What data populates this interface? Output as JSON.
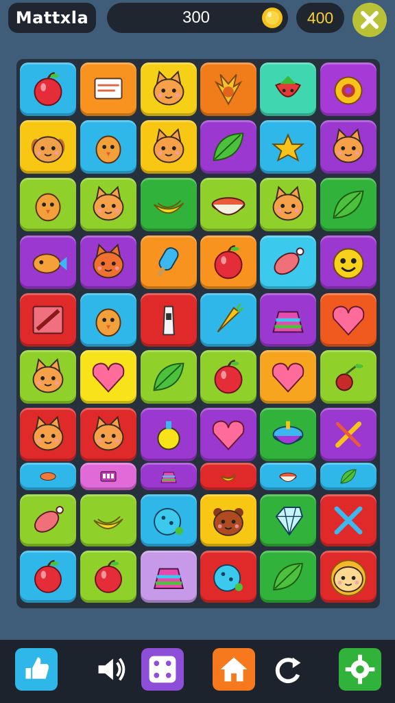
{
  "header": {
    "logo_text": "Mattxla",
    "score": "300",
    "best": "400"
  },
  "board": {
    "rows": [
      [
        {
          "color": "#2fb7ea",
          "icon": "apple-icon"
        },
        {
          "color": "#f7931e",
          "icon": "paper-icon"
        },
        {
          "color": "#f5d016",
          "icon": "cat-icon"
        },
        {
          "color": "#f07c1a",
          "icon": "phoenix-icon"
        },
        {
          "color": "#3fd6b0",
          "icon": "strawberry-icon"
        },
        {
          "color": "#a53ad6",
          "icon": "donut-icon"
        }
      ],
      [
        {
          "color": "#f8c713",
          "icon": "dog-icon"
        },
        {
          "color": "#2fb7ea",
          "icon": "bird-icon"
        },
        {
          "color": "#f8c713",
          "icon": "cat-icon"
        },
        {
          "color": "#9b38d0",
          "icon": "leaf-icon"
        },
        {
          "color": "#2fb7ea",
          "icon": "star-fish-icon"
        },
        {
          "color": "#9b38d0",
          "icon": "cat-icon"
        }
      ],
      [
        {
          "color": "#8fd12a",
          "icon": "bird-icon"
        },
        {
          "color": "#8fd12a",
          "icon": "cat-icon"
        },
        {
          "color": "#31b23a",
          "icon": "banana-icon"
        },
        {
          "color": "#8fd12a",
          "icon": "bowl-icon"
        },
        {
          "color": "#8fd12a",
          "icon": "cat-icon"
        },
        {
          "color": "#31b23a",
          "icon": "leaf-icon"
        }
      ],
      [
        {
          "color": "#9b38d0",
          "icon": "fish-icon"
        },
        {
          "color": "#9b38d0",
          "icon": "fox-icon"
        },
        {
          "color": "#f7931e",
          "icon": "popsicle-icon"
        },
        {
          "color": "#f7931e",
          "icon": "apple-icon"
        },
        {
          "color": "#3cc9ee",
          "icon": "meat-icon"
        },
        {
          "color": "#9b38d0",
          "icon": "smiley-icon"
        }
      ],
      [
        {
          "color": "#e02a2a",
          "icon": "pencil-icon"
        },
        {
          "color": "#2fb7ea",
          "icon": "bird-icon"
        },
        {
          "color": "#e02a2a",
          "icon": "bottle-icon"
        },
        {
          "color": "#2fb7ea",
          "icon": "carrot-icon"
        },
        {
          "color": "#9b38d0",
          "icon": "cake-icon"
        },
        {
          "color": "#f05a1e",
          "icon": "heart-icon"
        }
      ],
      [
        {
          "color": "#8fd12a",
          "icon": "cat-icon"
        },
        {
          "color": "#f8e21a",
          "icon": "heart-icon"
        },
        {
          "color": "#8fd12a",
          "icon": "leaf-icon"
        },
        {
          "color": "#8fd12a",
          "icon": "apple-icon"
        },
        {
          "color": "#f7a41e",
          "icon": "heart-icon"
        },
        {
          "color": "#8fd12a",
          "icon": "cherry-icon"
        }
      ],
      [
        {
          "color": "#e02a2a",
          "icon": "cat-icon"
        },
        {
          "color": "#e02a2a",
          "icon": "cat-icon"
        },
        {
          "color": "#9b38d0",
          "icon": "potion-icon"
        },
        {
          "color": "#9b38d0",
          "icon": "heart-icon"
        },
        {
          "color": "#31b23a",
          "icon": "spinning-top-icon"
        },
        {
          "color": "#9b38d0",
          "icon": "tools-icon"
        }
      ]
    ],
    "short_row": [
      {
        "color": "#2fb7ea",
        "icon": "bread-icon"
      },
      {
        "color": "#e06ad8",
        "icon": "panel-icon"
      },
      {
        "color": "#9b38d0",
        "icon": "cake-icon"
      },
      {
        "color": "#e02a2a",
        "icon": "banana-icon"
      },
      {
        "color": "#2fb7ea",
        "icon": "bowl-icon"
      },
      {
        "color": "#2fb7ea",
        "icon": "leaf-icon"
      }
    ],
    "rows_bottom": [
      [
        {
          "color": "#8fd12a",
          "icon": "meat-icon"
        },
        {
          "color": "#8fd12a",
          "icon": "banana-icon"
        },
        {
          "color": "#2fb7ea",
          "icon": "bubble-icon"
        },
        {
          "color": "#f8c713",
          "icon": "bear-icon"
        },
        {
          "color": "#31b23a",
          "icon": "gem-icon"
        },
        {
          "color": "#e02a2a",
          "icon": "cross-icon"
        }
      ],
      [
        {
          "color": "#2fb7ea",
          "icon": "apple-icon"
        },
        {
          "color": "#8fd12a",
          "icon": "apple-icon"
        },
        {
          "color": "#c69ae8",
          "icon": "cake-icon"
        },
        {
          "color": "#e02a2a",
          "icon": "bubble-icon"
        },
        {
          "color": "#31b23a",
          "icon": "leaf-icon"
        },
        {
          "color": "#e02a2a",
          "icon": "lion-icon"
        }
      ]
    ]
  },
  "nav": [
    {
      "icon": "thumbs-up-icon",
      "color": "#2fb7ea"
    },
    {
      "icon": "sound-icon",
      "color": "#1c232c"
    },
    {
      "icon": "dice-icon",
      "color": "#8e4fd8"
    },
    {
      "icon": "home-icon",
      "color": "#f7791e"
    },
    {
      "icon": "refresh-icon",
      "color": "#1c232c"
    },
    {
      "icon": "gear-icon",
      "color": "#31b23a"
    }
  ]
}
